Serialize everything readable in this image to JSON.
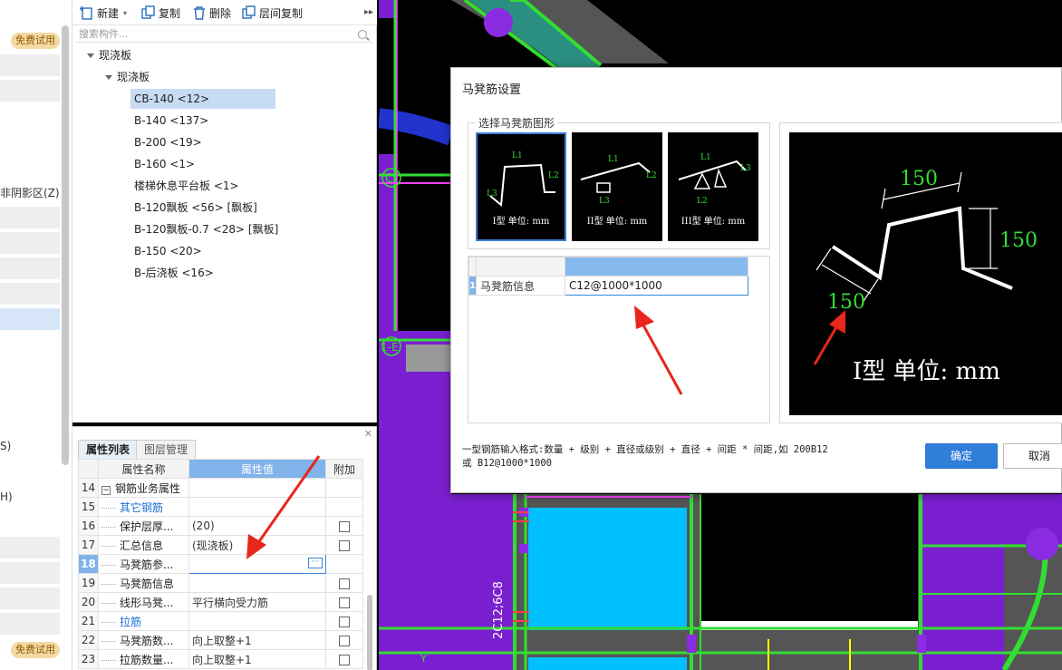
{
  "left_strip": {
    "trial_badge": "免费试用",
    "shadow_area_label": "非阴影区(Z)",
    "label_s": "S)",
    "label_h": "H)"
  },
  "toolbar": {
    "new_label": "新建",
    "copy_label": "复制",
    "delete_label": "删除",
    "floor_copy_label": "层间复制"
  },
  "search": {
    "placeholder": "搜索构件..."
  },
  "tree": {
    "root": "现浇板",
    "group": "现浇板",
    "items": [
      "CB-140 <12>",
      "B-140 <137>",
      "B-200 <19>",
      "B-160 <1>",
      "楼梯休息平台板 <1>",
      "B-120飘板 <56> [飘板]",
      "B-120飘板-0.7 <28> [飘板]",
      "B-150 <20>",
      "B-后浇板 <16>"
    ]
  },
  "props": {
    "tab_active": "属性列表",
    "tab_inactive": "图层管理",
    "col_name": "属性名称",
    "col_value": "属性值",
    "col_extra": "附加",
    "rows": [
      {
        "num": "14",
        "name": "钢筋业务属性",
        "value": ""
      },
      {
        "num": "15",
        "name": "其它钢筋",
        "value": ""
      },
      {
        "num": "16",
        "name": "保护层厚...",
        "value": "(20)"
      },
      {
        "num": "17",
        "name": "汇总信息",
        "value": "(现浇板)"
      },
      {
        "num": "18",
        "name": "马凳筋参...",
        "value": ""
      },
      {
        "num": "19",
        "name": "马凳筋信息",
        "value": ""
      },
      {
        "num": "20",
        "name": "线形马凳...",
        "value": "平行横向受力筋"
      },
      {
        "num": "21",
        "name": "拉筋",
        "value": ""
      },
      {
        "num": "22",
        "name": "马凳筋数...",
        "value": "向上取整+1"
      },
      {
        "num": "23",
        "name": "拉筋数量...",
        "value": "向上取整+1"
      }
    ]
  },
  "dialog": {
    "title": "马凳筋设置",
    "shape_group_title": "选择马凳筋图形",
    "shapes": [
      {
        "caption": "I型 单位: mm",
        "l1": "L1",
        "l2": "L2",
        "l3": "L3"
      },
      {
        "caption": "II型 单位: mm",
        "l1": "L1",
        "l2": "L2",
        "l3": "L3"
      },
      {
        "caption": "III型 单位: mm",
        "l1": "L1",
        "l2": "L2",
        "l3": "L3"
      }
    ],
    "info_row_index": "1",
    "info_label": "马凳筋信息",
    "info_value": "C12@1000*1000",
    "preview": {
      "dim_top": "150",
      "dim_right": "150",
      "dim_left": "150",
      "caption": "I型 单位: mm"
    },
    "hint_line1": "一型钢筋输入格式:数量 + 级别 + 直径或级别 + 直径 + 间距 * 间距,如 200B12",
    "hint_line2": "或 B12@1000*1000",
    "ok_label": "确定",
    "cancel_label": "取消"
  },
  "cad": {
    "label_axis_c": "C",
    "label_axis_e": "1-E",
    "rebar_label": "2C12;6C8",
    "axis_y": "Y"
  },
  "colors": {
    "accent": "#2f7fd9",
    "cad_green": "#33dd33",
    "cad_purple": "#8b2be2",
    "cad_cyan": "#00bfff",
    "cad_magenta": "#ff40ff",
    "arrow_red": "#e8261c"
  }
}
